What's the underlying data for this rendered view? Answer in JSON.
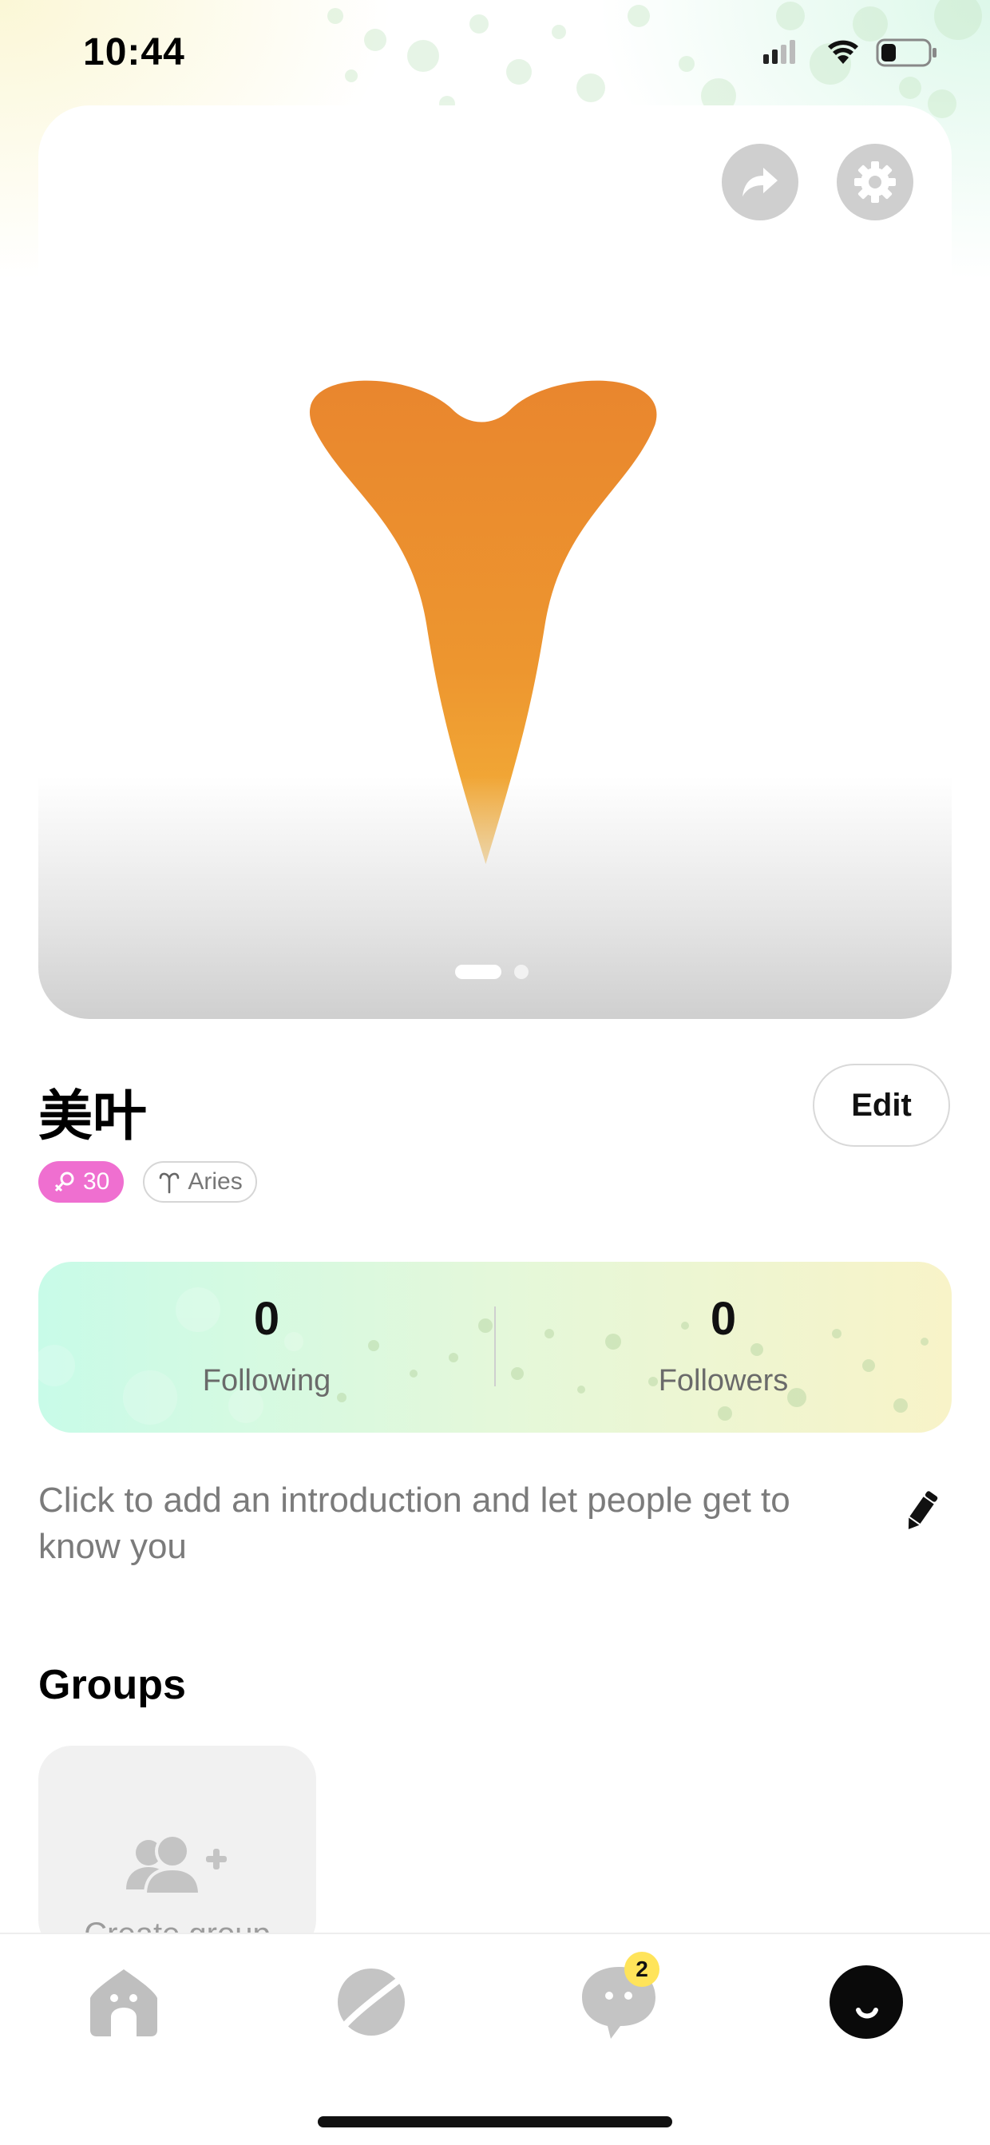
{
  "status_bar": {
    "time": "10:44"
  },
  "profile": {
    "name": "美叶",
    "edit_label": "Edit",
    "age": "30",
    "zodiac": "Aries",
    "accent_leaf_color": "#ee8f33",
    "age_badge_color": "#ef6fd0"
  },
  "photo_pager": {
    "total": 2,
    "current": 1
  },
  "stats": {
    "following_count": "0",
    "following_label": "Following",
    "followers_count": "0",
    "followers_label": "Followers"
  },
  "intro": {
    "placeholder": "Click to add an introduction and let people get to know you"
  },
  "groups": {
    "title": "Groups",
    "create_label": "Create group"
  },
  "tabbar": {
    "items": [
      {
        "icon": "home-icon"
      },
      {
        "icon": "planet-icon"
      },
      {
        "icon": "chat-bubble-icon"
      },
      {
        "icon": "avatar-smile-icon"
      }
    ],
    "messages_badge": "2",
    "badge_color": "#ffe45a"
  }
}
